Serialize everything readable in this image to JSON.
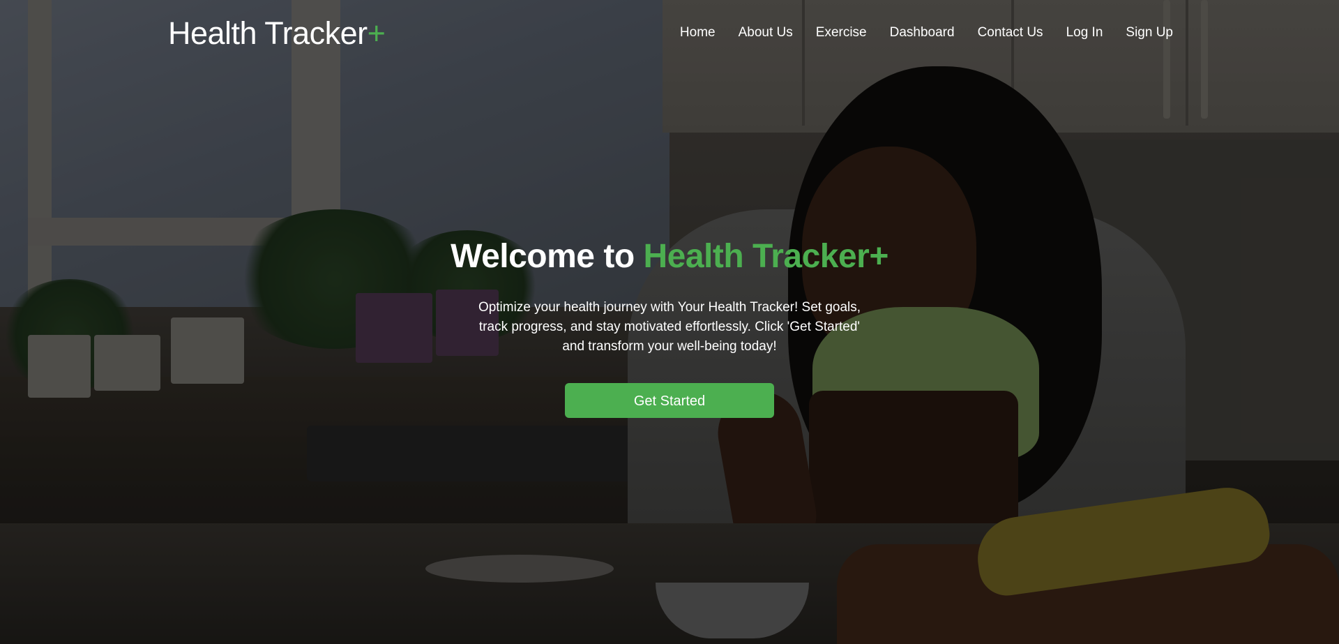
{
  "header": {
    "logo_text": "Health Tracker",
    "logo_plus": "+",
    "nav": [
      {
        "label": "Home"
      },
      {
        "label": "About Us"
      },
      {
        "label": "Exercise"
      },
      {
        "label": "Dashboard"
      },
      {
        "label": "Contact Us"
      },
      {
        "label": "Log In"
      },
      {
        "label": "Sign Up"
      }
    ]
  },
  "hero": {
    "title_prefix": "Welcome to",
    "title_accent": "Health Tracker+",
    "description": "Optimize your health journey with Your Health Tracker! Set goals, track progress, and stay motivated effortlessly. Click 'Get Started' and transform your well-being today!",
    "cta_label": "Get Started"
  },
  "colors": {
    "accent": "#4caf50",
    "text": "#ffffff"
  }
}
